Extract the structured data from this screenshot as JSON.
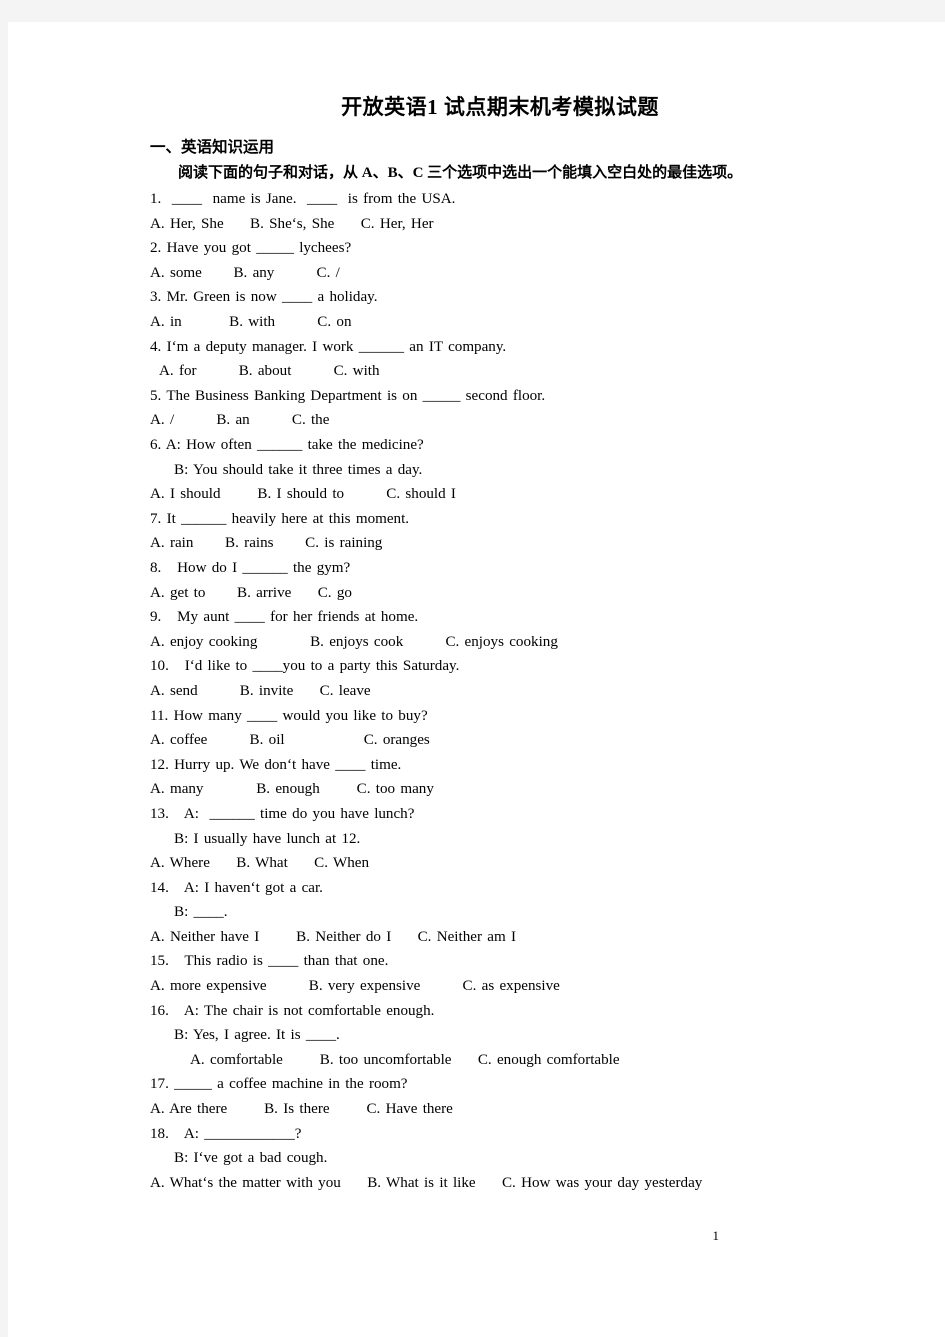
{
  "document": {
    "title": "开放英语1  试点期末机考模拟试题",
    "page_number": "1"
  },
  "section": {
    "heading": "一、英语知识运用",
    "instruction": "阅读下面的句子和对话，从 A、B、C 三个选项中选出一个能填入空白处的最佳选项。"
  },
  "lines": [
    {
      "text": "1.  ____  name is Jane.  ____  is from the USA.",
      "indent": 0
    },
    {
      "text": "A. Her, She     B. She‘s, She     C. Her, Her",
      "indent": 0
    },
    {
      "text": "2. Have you got _____ lychees?",
      "indent": 0
    },
    {
      "text": "A. some      B. any        C. /",
      "indent": 0
    },
    {
      "text": "3. Mr. Green is now ____ a holiday.",
      "indent": 0
    },
    {
      "text": "A. in         B. with        C. on",
      "indent": 0
    },
    {
      "text": "4. I‘m a deputy manager. I work ______ an IT company.",
      "indent": 0
    },
    {
      "text": "A. for        B. about        C. with",
      "indent": 1
    },
    {
      "text": "5. The Business Banking Department is on _____ second floor.",
      "indent": 0
    },
    {
      "text": "A. /        B. an        C. the",
      "indent": 0
    },
    {
      "text": "6. A: How often ______ take the medicine?",
      "indent": 0
    },
    {
      "text": "B: You should take it three times a day.",
      "indent": 2
    },
    {
      "text": "A. I should       B. I should to        C. should I",
      "indent": 0
    },
    {
      "text": "7. It ______ heavily here at this moment.",
      "indent": 0
    },
    {
      "text": "A. rain      B. rains      C. is raining",
      "indent": 0
    },
    {
      "text": "8.   How do I ______ the gym?",
      "indent": 0
    },
    {
      "text": "A. get to      B. arrive     C. go",
      "indent": 0
    },
    {
      "text": "9.   My aunt ____ for her friends at home.",
      "indent": 0
    },
    {
      "text": "A. enjoy cooking          B. enjoys cook        C. enjoys cooking",
      "indent": 0
    },
    {
      "text": "10.   I‘d like to ____you to a party this Saturday.",
      "indent": 0
    },
    {
      "text": "A. send        B. invite     C. leave",
      "indent": 0
    },
    {
      "text": "11. How many ____ would you like to buy?",
      "indent": 0
    },
    {
      "text": "A. coffee        B. oil               C. oranges",
      "indent": 0
    },
    {
      "text": "12. Hurry up. We don‘t have ____ time.",
      "indent": 0
    },
    {
      "text": "A. many          B. enough       C. too many",
      "indent": 0
    },
    {
      "text": "13.   A:  ______ time do you have lunch?",
      "indent": 0
    },
    {
      "text": "B: I usually have lunch at 12.",
      "indent": 2
    },
    {
      "text": "A. Where     B. What     C. When",
      "indent": 0
    },
    {
      "text": "14.   A: I haven‘t got a car.",
      "indent": 0
    },
    {
      "text": "B: ____.",
      "indent": 2
    },
    {
      "text": "A. Neither have I       B. Neither do I     C. Neither am I",
      "indent": 0
    },
    {
      "text": "15.   This radio is ____ than that one.",
      "indent": 0
    },
    {
      "text": "A. more expensive        B. very expensive        C. as expensive",
      "indent": 0
    },
    {
      "text": "16.   A: The chair is not comfortable enough.",
      "indent": 0
    },
    {
      "text": "B: Yes, I agree. It is ____.",
      "indent": 2
    },
    {
      "text": "A. comfortable       B. too uncomfortable     C. enough comfortable",
      "indent": 3
    },
    {
      "text": "17. _____ a coffee machine in the room?",
      "indent": 0
    },
    {
      "text": "A. Are there       B. Is there       C. Have there",
      "indent": 0
    },
    {
      "text": "18.   A: ____________?",
      "indent": 0
    },
    {
      "text": "B: I‘ve got a bad cough.",
      "indent": 2
    },
    {
      "text": "A. What‘s the matter with you     B. What is it like     C. How was your day yesterday",
      "indent": 0
    }
  ]
}
